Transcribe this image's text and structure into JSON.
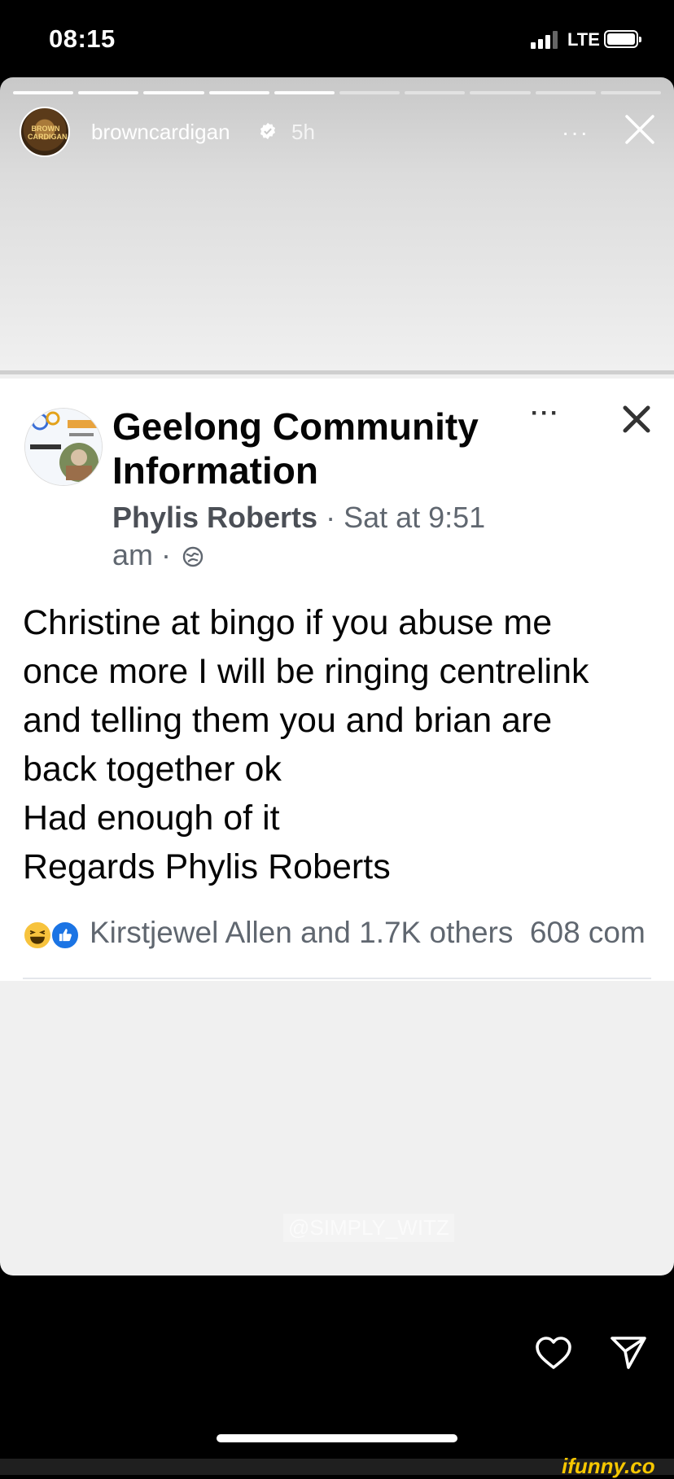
{
  "status_bar": {
    "time": "08:15",
    "network": "LTE"
  },
  "story": {
    "username": "browncardigan",
    "time_ago": "5h",
    "more_label": "···",
    "progress_total": 10,
    "progress_done": 5,
    "watermark": "@SIMPLY_WITZ"
  },
  "post": {
    "page_name_line1": "Geelong Community",
    "page_name_line2": "Information",
    "author": "Phylis Roberts",
    "meta_time_line1": " · Sat at 9:51",
    "meta_time_line2": "am · ",
    "more_label": "···",
    "body_lines": [
      "Christine at bingo if you abuse me",
      "once more I will be ringing centrelink",
      "and telling them you and brian are",
      "back together ok",
      "Had enough of it",
      "Regards Phylis Roberts"
    ],
    "reactions_text": "Kirstjewel Allen and 1.7K others",
    "comments_text": "608 com"
  },
  "footer": {
    "brand": "ifunny.co"
  },
  "icons": [
    "verified-icon",
    "close-icon",
    "globe-icon",
    "haha-reaction-icon",
    "like-reaction-icon",
    "heart-icon",
    "send-icon"
  ],
  "colors": {
    "like_blue": "#1b74e4",
    "haha_yellow": "#f7c33d",
    "ifunny_yellow": "#f6c700"
  }
}
